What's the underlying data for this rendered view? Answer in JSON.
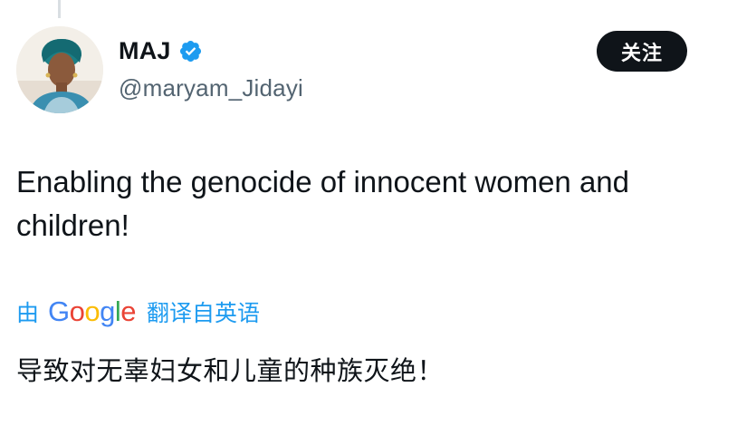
{
  "author": {
    "display_name": "MAJ",
    "handle": "@maryam_Jidayi",
    "avatar_icon": "profile-photo",
    "verified_icon": "verified-badge-icon",
    "verified_color": "#1d9bf0"
  },
  "follow_button": {
    "label": "关注"
  },
  "tweet": {
    "text": "Enabling the genocide of innocent women and children!"
  },
  "translation": {
    "by_label": "由",
    "provider_letters": [
      "G",
      "o",
      "o",
      "g",
      "l",
      "e"
    ],
    "from_label": "翻译自英语",
    "text": "导致对无辜妇女和儿童的种族灭绝！",
    "link_color": "#1d9bf0"
  }
}
